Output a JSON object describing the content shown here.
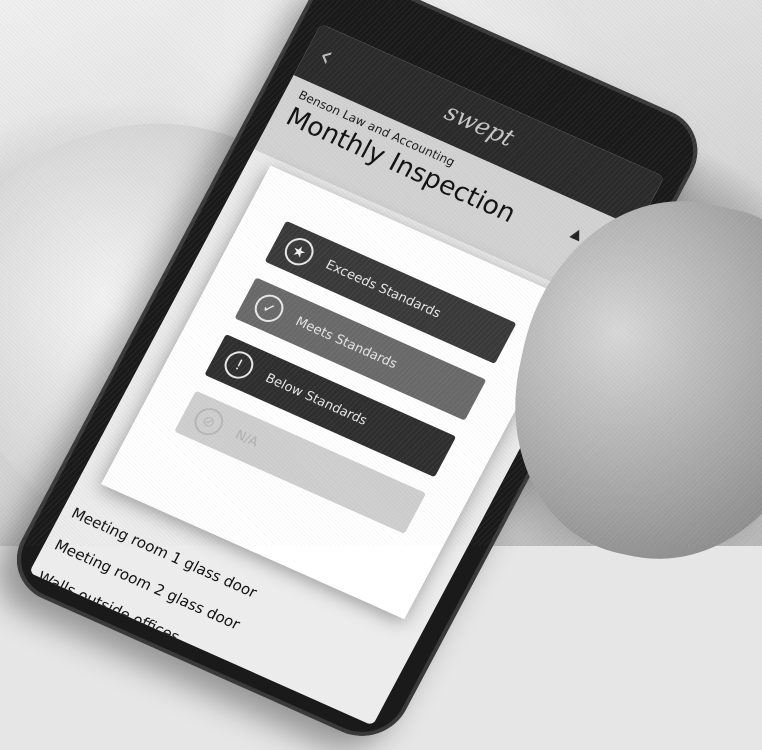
{
  "app": {
    "brand": "swept",
    "back_icon": "chevron-left-icon"
  },
  "header": {
    "client": "Benson Law and Accounting",
    "title": "Monthly Inspection",
    "icons": [
      "alert-icon",
      "gear-icon"
    ]
  },
  "list": {
    "items": [
      {
        "label": "Meeting room 1 glass door"
      },
      {
        "label": "Meeting room 2 glass door"
      },
      {
        "label": "Walls outside offices"
      }
    ]
  },
  "rating_modal": {
    "options": [
      {
        "label": "Exceeds Standards",
        "icon": "star-icon",
        "color": "#3a3a3a"
      },
      {
        "label": "Meets Standards",
        "icon": "check-icon",
        "color": "#6a6a6a"
      },
      {
        "label": "Below Standards",
        "icon": "exclamation-icon",
        "color": "#2f2f2f"
      },
      {
        "label": "N/A",
        "icon": "na-icon",
        "color": "#cfcfcf"
      }
    ]
  }
}
